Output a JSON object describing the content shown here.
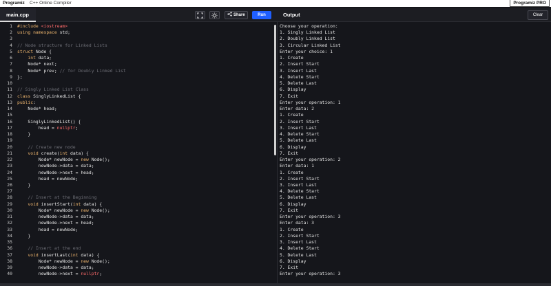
{
  "topbar": {
    "brand": "Programiz",
    "title": "C++ Online Compiler",
    "pro_label": "Programiz PRO"
  },
  "toolbar": {
    "file_tab": "main.cpp",
    "fullscreen_icon": "fullscreen-icon",
    "theme_icon": "sun-icon",
    "share_label": "Share",
    "run_label": "Run",
    "output_label": "Output",
    "clear_label": "Clear"
  },
  "editor": {
    "lines": [
      {
        "n": "1",
        "t": [
          [
            "pp",
            "#include "
          ],
          [
            "str",
            "<iostream>"
          ]
        ]
      },
      {
        "n": "2",
        "t": [
          [
            "kw",
            "using namespace "
          ],
          [
            "",
            "std;"
          ]
        ]
      },
      {
        "n": "3",
        "t": []
      },
      {
        "n": "4",
        "t": [
          [
            "cm",
            "// Node structure for Linked Lists"
          ]
        ]
      },
      {
        "n": "5",
        "t": [
          [
            "kw",
            "struct "
          ],
          [
            "",
            "Node {"
          ]
        ]
      },
      {
        "n": "6",
        "t": [
          [
            "",
            "    "
          ],
          [
            "kw",
            "int "
          ],
          [
            "",
            "data;"
          ]
        ]
      },
      {
        "n": "7",
        "t": [
          [
            "",
            "    Node* next;"
          ]
        ]
      },
      {
        "n": "8",
        "t": [
          [
            "",
            "    Node* prev; "
          ],
          [
            "cm",
            "// for Doubly Linked List"
          ]
        ]
      },
      {
        "n": "9",
        "t": [
          [
            "",
            "};"
          ]
        ]
      },
      {
        "n": "10",
        "t": []
      },
      {
        "n": "11",
        "t": [
          [
            "cm",
            "// Singly Linked List Class"
          ]
        ]
      },
      {
        "n": "12",
        "t": [
          [
            "kw",
            "class "
          ],
          [
            "",
            "SinglyLinkedList {"
          ]
        ]
      },
      {
        "n": "13",
        "t": [
          [
            "kw",
            "public"
          ],
          [
            "",
            ":"
          ]
        ]
      },
      {
        "n": "14",
        "t": [
          [
            "",
            "    Node* head;"
          ]
        ]
      },
      {
        "n": "15",
        "t": []
      },
      {
        "n": "16",
        "t": [
          [
            "",
            "    SinglyLinkedList() {"
          ]
        ]
      },
      {
        "n": "17",
        "t": [
          [
            "",
            "        head = "
          ],
          [
            "lit",
            "nullptr"
          ],
          [
            "",
            ";"
          ]
        ]
      },
      {
        "n": "18",
        "t": [
          [
            "",
            "    }"
          ]
        ]
      },
      {
        "n": "19",
        "t": []
      },
      {
        "n": "20",
        "t": [
          [
            "",
            "    "
          ],
          [
            "cm",
            "// Create new node"
          ]
        ]
      },
      {
        "n": "21",
        "t": [
          [
            "",
            "    "
          ],
          [
            "kw",
            "void "
          ],
          [
            "",
            "create("
          ],
          [
            "kw",
            "int "
          ],
          [
            "",
            "data) {"
          ]
        ]
      },
      {
        "n": "22",
        "t": [
          [
            "",
            "        Node* newNode = "
          ],
          [
            "kw",
            "new "
          ],
          [
            "",
            "Node();"
          ]
        ]
      },
      {
        "n": "23",
        "t": [
          [
            "",
            "        newNode->data = data;"
          ]
        ]
      },
      {
        "n": "24",
        "t": [
          [
            "",
            "        newNode->next = head;"
          ]
        ]
      },
      {
        "n": "25",
        "t": [
          [
            "",
            "        head = newNode;"
          ]
        ]
      },
      {
        "n": "26",
        "t": [
          [
            "",
            "    }"
          ]
        ]
      },
      {
        "n": "27",
        "t": []
      },
      {
        "n": "28",
        "t": [
          [
            "",
            "    "
          ],
          [
            "cm",
            "// Insert at the Beginning"
          ]
        ]
      },
      {
        "n": "29",
        "t": [
          [
            "",
            "    "
          ],
          [
            "kw",
            "void "
          ],
          [
            "",
            "insertStart("
          ],
          [
            "kw",
            "int "
          ],
          [
            "",
            "data) {"
          ]
        ]
      },
      {
        "n": "30",
        "t": [
          [
            "",
            "        Node* newNode = "
          ],
          [
            "kw",
            "new "
          ],
          [
            "",
            "Node();"
          ]
        ]
      },
      {
        "n": "31",
        "t": [
          [
            "",
            "        newNode->data = data;"
          ]
        ]
      },
      {
        "n": "32",
        "t": [
          [
            "",
            "        newNode->next = head;"
          ]
        ]
      },
      {
        "n": "33",
        "t": [
          [
            "",
            "        head = newNode;"
          ]
        ]
      },
      {
        "n": "34",
        "t": [
          [
            "",
            "    }"
          ]
        ]
      },
      {
        "n": "35",
        "t": []
      },
      {
        "n": "36",
        "t": [
          [
            "",
            "    "
          ],
          [
            "cm",
            "// Insert at the end"
          ]
        ]
      },
      {
        "n": "37",
        "t": [
          [
            "",
            "    "
          ],
          [
            "kw",
            "void "
          ],
          [
            "",
            "insertLast("
          ],
          [
            "kw",
            "int "
          ],
          [
            "",
            "data) {"
          ]
        ]
      },
      {
        "n": "38",
        "t": [
          [
            "",
            "        Node* newNode = "
          ],
          [
            "kw",
            "new "
          ],
          [
            "",
            "Node();"
          ]
        ]
      },
      {
        "n": "39",
        "t": [
          [
            "",
            "        newNode->data = data;"
          ]
        ]
      },
      {
        "n": "40",
        "t": [
          [
            "",
            "        newNode->next = "
          ],
          [
            "lit",
            "nullptr"
          ],
          [
            "",
            ";"
          ]
        ]
      }
    ]
  },
  "output": {
    "lines": [
      "Choose your operation:",
      "1. Singly Linked List",
      "2. Doubly Linked List",
      "3. Circular Linked List",
      "Enter your choice: 1",
      "1. Create",
      "2. Insert Start",
      "3. Insert Last",
      "4. Delete Start",
      "5. Delete Last",
      "6. Display",
      "7. Exit",
      "Enter your operation: 1",
      "Enter data: 2",
      "1. Create",
      "2. Insert Start",
      "3. Insert Last",
      "4. Delete Start",
      "5. Delete Last",
      "6. Display",
      "7. Exit",
      "Enter your operation: 2",
      "Enter data: 1",
      "1. Create",
      "2. Insert Start",
      "3. Insert Last",
      "4. Delete Start",
      "5. Delete Last",
      "6. Display",
      "7. Exit",
      "Enter your operation: 3",
      "Enter data: 3",
      "1. Create",
      "2. Insert Start",
      "3. Insert Last",
      "4. Delete Start",
      "5. Delete Last",
      "6. Display",
      "7. Exit",
      "Enter your operation: 3"
    ]
  }
}
